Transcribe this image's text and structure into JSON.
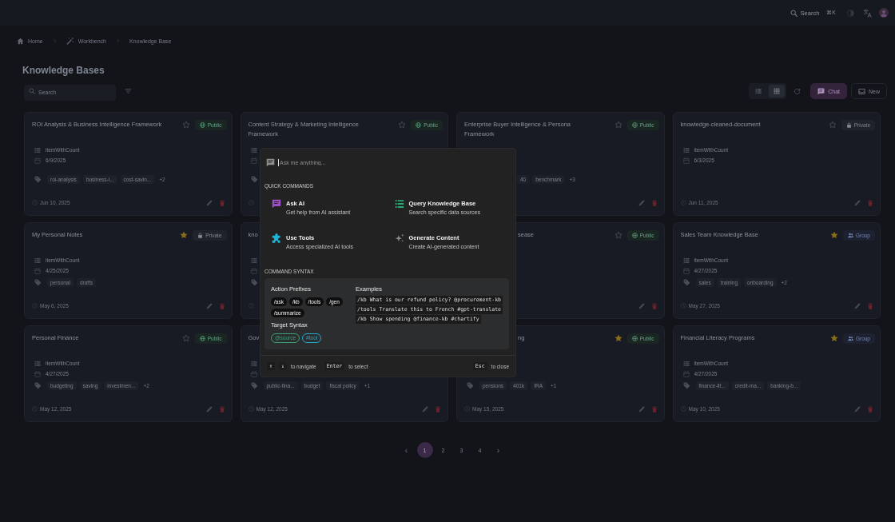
{
  "top_bar": {
    "search": {
      "label": "Search",
      "shortcut": "⌘K"
    }
  },
  "breadcrumb": [
    {
      "kind": "home",
      "label": "Home"
    },
    {
      "kind": "workbench",
      "label": "Workbench"
    },
    {
      "kind": "current",
      "label": "Knowledge Base"
    }
  ],
  "title": "Knowledge Bases",
  "toolbar": {
    "search": {
      "placeholder": "Search"
    },
    "views": [
      {
        "kind": "list",
        "selected": false
      },
      {
        "kind": "grid",
        "selected": true
      }
    ],
    "buttons": [
      {
        "kind": "chat",
        "label": "Chat"
      },
      {
        "kind": "new",
        "label": "New"
      }
    ]
  },
  "cards": [
    {
      "title": "ROI Analysis & Business Intelligence Framework",
      "starred": false,
      "access": {
        "kind": "public",
        "label": "Public"
      },
      "details": [
        {
          "kind": "items",
          "text": "itemWithCount"
        },
        {
          "kind": "date",
          "text": "6/9/2025"
        },
        {
          "kind": "tags",
          "items": [
            "roi-analysis",
            "business-i...",
            "cost-savin..."
          ],
          "more": "+2"
        },
        {
          "kind": "updated",
          "text": "Jun 10, 2025"
        }
      ],
      "actions": [
        {
          "kind": "edit"
        },
        {
          "kind": "delete"
        }
      ]
    },
    {
      "title": "Content Strategy & Marketing Intelligence Framework",
      "starred": false,
      "access": {
        "kind": "public",
        "label": "Public"
      },
      "details": [
        {
          "kind": "items"
        },
        {
          "kind": "date"
        },
        {
          "kind": "tags"
        },
        {
          "kind": "updated"
        }
      ]
    },
    {
      "title": "Enterprise Buyer Intelligence & Persona Framework",
      "starred": false,
      "access": {
        "kind": "public",
        "label": "Public"
      },
      "details": [
        {
          "kind": "tags",
          "left_covered": true,
          "items": [
            "40",
            "benchmark"
          ],
          "more": "+3"
        }
      ],
      "actions": [
        {
          "kind": "edit"
        },
        {
          "kind": "delete"
        }
      ]
    },
    {
      "title": "knowledge-cleaned-document",
      "starred": false,
      "access": {
        "kind": "private",
        "label": "Private"
      },
      "details": [
        {
          "kind": "items",
          "text": "itemWithCount"
        },
        {
          "kind": "date",
          "text": "6/3/2025"
        },
        {
          "kind": "updated",
          "text": "Jun 11, 2025"
        }
      ],
      "actions": [
        {
          "kind": "edit"
        },
        {
          "kind": "delete"
        }
      ]
    },
    {
      "title": "My Personal Notes",
      "starred": true,
      "access": {
        "kind": "private",
        "label": "Private"
      },
      "details": [
        {
          "kind": "items",
          "text": "itemWithCount"
        },
        {
          "kind": "date",
          "text": "4/25/2025"
        },
        {
          "kind": "tags",
          "items": [
            "personal",
            "drafts"
          ]
        },
        {
          "kind": "updated",
          "text": "May 6, 2025"
        }
      ],
      "actions": [
        {
          "kind": "edit"
        },
        {
          "kind": "delete"
        }
      ]
    },
    {
      "title": "kno",
      "details": [
        {
          "kind": "items"
        },
        {
          "kind": "date"
        },
        {
          "kind": "tags"
        },
        {
          "kind": "updated"
        }
      ]
    },
    {
      "title": "sease",
      "title_left_covered": true,
      "starred": false,
      "access": {
        "kind": "public",
        "label": "Public"
      },
      "actions": [
        {
          "kind": "edit"
        },
        {
          "kind": "delete"
        }
      ]
    },
    {
      "title": "Sales Team Knowledge Base",
      "starred": true,
      "access": {
        "kind": "group",
        "label": "Group"
      },
      "details": [
        {
          "kind": "items",
          "text": "itemWithCount"
        },
        {
          "kind": "date",
          "text": "4/27/2025"
        },
        {
          "kind": "tags",
          "items": [
            "sales",
            "training",
            "onboarding"
          ],
          "more": "+2"
        },
        {
          "kind": "updated",
          "text": "May 27, 2025"
        }
      ],
      "actions": [
        {
          "kind": "edit"
        },
        {
          "kind": "delete"
        }
      ]
    },
    {
      "title": "Personal Finance",
      "starred": false,
      "access": {
        "kind": "public",
        "label": "Public"
      },
      "details": [
        {
          "kind": "items",
          "text": "itemWithCount"
        },
        {
          "kind": "date",
          "text": "4/27/2025"
        },
        {
          "kind": "tags",
          "items": [
            "budgeting",
            "saving",
            "investmen..."
          ],
          "more": "+2"
        },
        {
          "kind": "updated",
          "text": "May 12, 2025"
        }
      ],
      "actions": [
        {
          "kind": "edit"
        },
        {
          "kind": "delete"
        }
      ]
    },
    {
      "title": "Gov",
      "details": [
        {
          "kind": "items"
        },
        {
          "kind": "date"
        },
        {
          "kind": "tags",
          "items": [
            "public-fina...",
            "budget",
            "fiscal policy"
          ],
          "more": "+1"
        },
        {
          "kind": "updated",
          "text": "May 12, 2025"
        }
      ],
      "actions": [
        {
          "kind": "edit"
        },
        {
          "kind": "delete"
        }
      ]
    },
    {
      "title": "ng",
      "title_left_covered": true,
      "starred": true,
      "access": {
        "kind": "public",
        "label": "Public"
      },
      "details": [
        {
          "kind": "tags",
          "items": [
            "pensions",
            "401k",
            "IRA"
          ],
          "more": "+1"
        },
        {
          "kind": "updated",
          "text": "May 15, 2025"
        }
      ],
      "actions": [
        {
          "kind": "edit"
        },
        {
          "kind": "delete"
        }
      ]
    },
    {
      "title": "Financial Literacy Programs",
      "starred": true,
      "access": {
        "kind": "group",
        "label": "Group"
      },
      "details": [
        {
          "kind": "items",
          "text": "itemWithCount"
        },
        {
          "kind": "date",
          "text": "4/27/2025"
        },
        {
          "kind": "tags",
          "items": [
            "finance-lit...",
            "credit-ma...",
            "banking-b..."
          ]
        },
        {
          "kind": "updated",
          "text": "May 10, 2025"
        }
      ],
      "actions": [
        {
          "kind": "edit"
        },
        {
          "kind": "delete"
        }
      ]
    }
  ],
  "pagination": {
    "previous": "‹",
    "pages": [
      {
        "label": "1",
        "selected": true
      },
      {
        "label": "2",
        "selected": false
      },
      {
        "label": "3",
        "selected": false
      },
      {
        "label": "4",
        "selected": false
      }
    ],
    "next": "›"
  },
  "command_palette": {
    "input": {
      "placeholder": "Ask me anything...",
      "focused": true
    },
    "quick_commands": {
      "heading": "QUICK COMMANDS",
      "items": [
        {
          "kind": "ask",
          "title": "Ask AI",
          "subtitle": "Get help from AI assistant"
        },
        {
          "kind": "query",
          "title": "Query Knowledge Base",
          "subtitle": "Search specific data sources"
        },
        {
          "kind": "tools",
          "title": "Use Tools",
          "subtitle": "Access specialized AI tools"
        },
        {
          "kind": "generate",
          "title": "Generate Content",
          "subtitle": "Create AI-generated content"
        }
      ]
    },
    "command_syntax": {
      "heading": "COMMAND SYNTAX",
      "action_prefixes": {
        "title": "Action Prefixes",
        "items": [
          "/ask",
          "/kb",
          "/tools",
          "/gen",
          "/summarize"
        ]
      },
      "target_syntax": {
        "title": "Target Syntax",
        "items": [
          {
            "label": "@source",
            "color": "#3a9f78"
          },
          {
            "label": "#tool",
            "color": "#23a9c9"
          }
        ]
      },
      "examples": {
        "title": "Examples",
        "items": [
          "/kb What is our refund policy? @procurement-kb",
          "/tools Translate this to French #gpt-translate",
          "/kb Show spending @finance-kb #chartify"
        ]
      }
    },
    "hints": [
      {
        "keys": [
          "↑",
          "↓"
        ],
        "label": "to navigate"
      },
      {
        "keys": [
          "Enter"
        ],
        "label": "to select"
      },
      {
        "keys": [
          "Esc"
        ],
        "label": "to close"
      }
    ]
  }
}
